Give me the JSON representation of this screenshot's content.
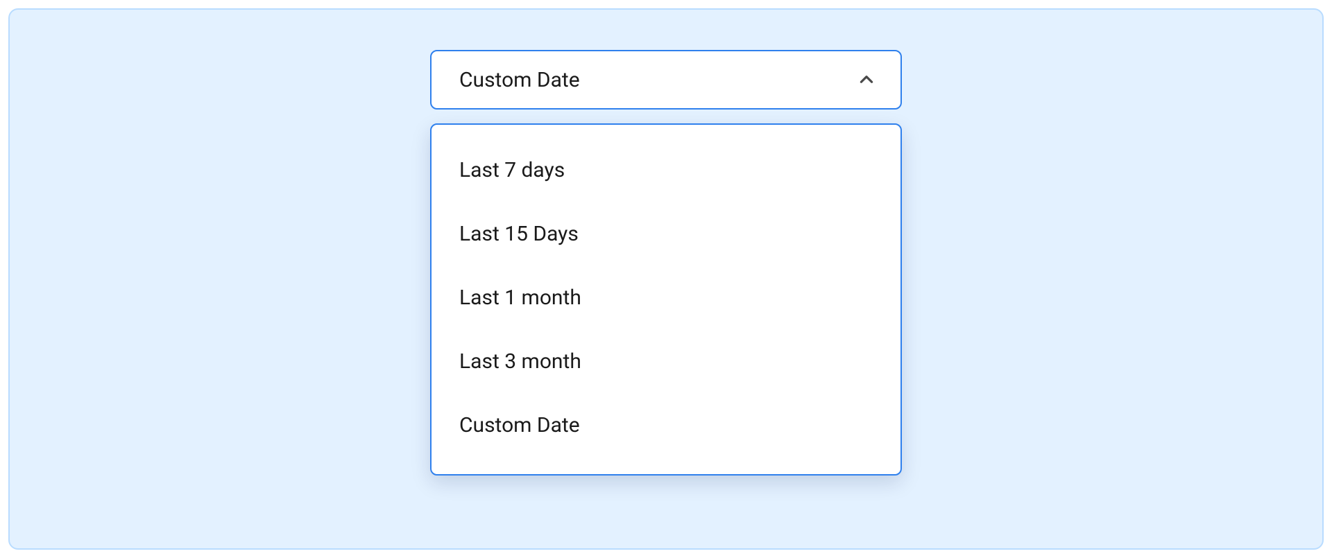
{
  "colors": {
    "panel_bg": "#e3f1ff",
    "panel_border": "#b9dcff",
    "accent": "#2f80ed",
    "text": "#1a1a1a",
    "icon": "#4a4a4a"
  },
  "dropdown": {
    "selected_label": "Custom Date",
    "options": [
      {
        "label": "Last 7 days"
      },
      {
        "label": "Last 15 Days"
      },
      {
        "label": "Last 1 month"
      },
      {
        "label": "Last 3 month"
      },
      {
        "label": "Custom Date"
      }
    ],
    "icon_name": "chevron-up-icon"
  }
}
